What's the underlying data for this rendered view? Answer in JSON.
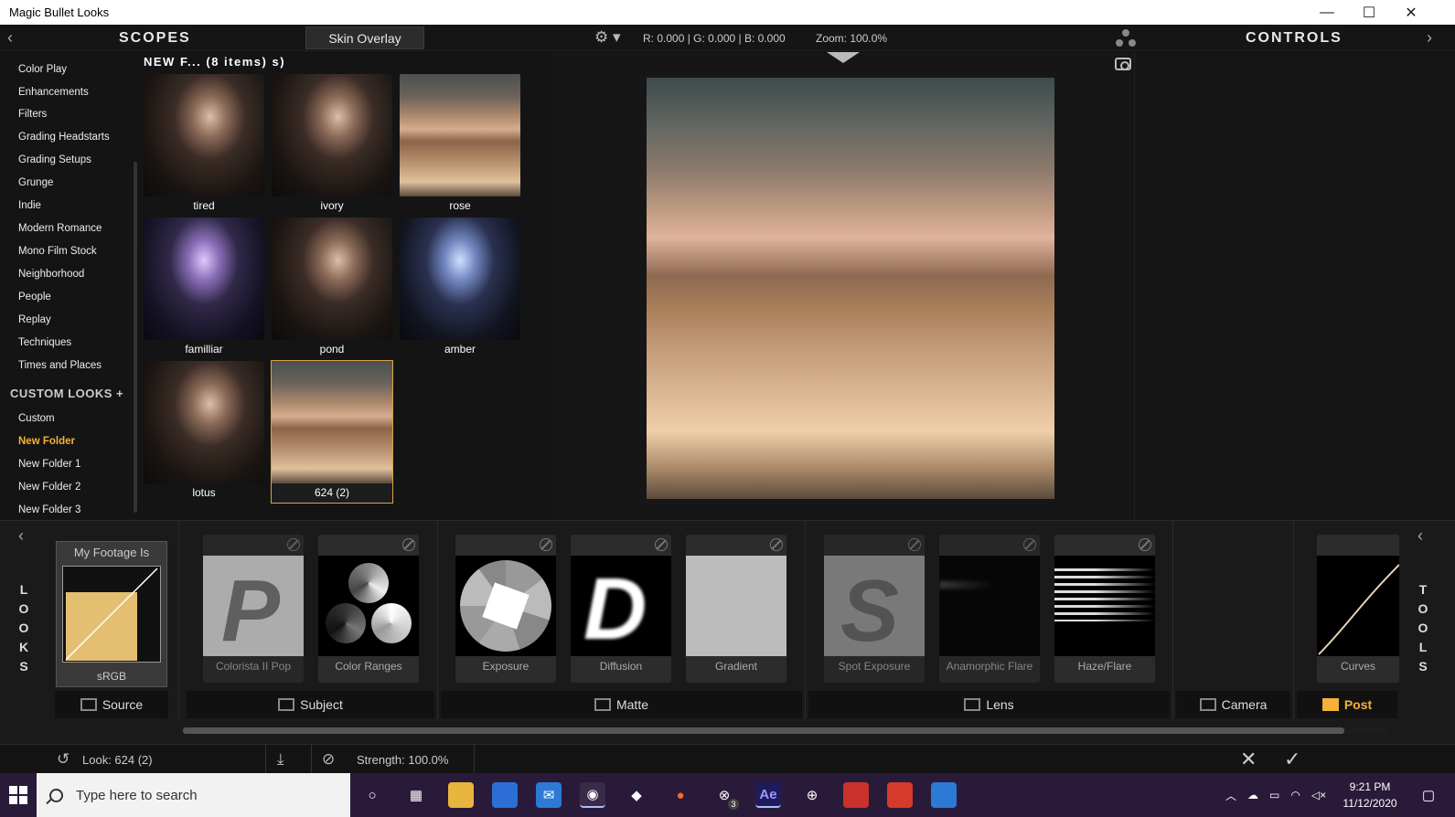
{
  "window": {
    "title": "Magic Bullet Looks",
    "minimize_glyph": "—",
    "maximize_glyph": "☐",
    "close_glyph": "✕"
  },
  "header": {
    "scopes_title": "SCOPES",
    "controls_title": "CONTROLS",
    "skin_tab": "Skin Overlay",
    "rgb_readout": "R: 0.000 | G: 0.000 | B: 0.000",
    "zoom_readout": "Zoom: 100.0%",
    "left_arrow": "‹",
    "right_arrow": "›",
    "gear_glyph": "⚙ ▾"
  },
  "sidebar": {
    "categories": [
      {
        "label": "Color Play"
      },
      {
        "label": "Enhancements"
      },
      {
        "label": "Filters"
      },
      {
        "label": "Grading Headstarts"
      },
      {
        "label": "Grading Setups"
      },
      {
        "label": "Grunge"
      },
      {
        "label": "Indie"
      },
      {
        "label": "Modern Romance"
      },
      {
        "label": "Mono Film Stock"
      },
      {
        "label": "Neighborhood"
      },
      {
        "label": "People"
      },
      {
        "label": "Replay"
      },
      {
        "label": "Techniques"
      },
      {
        "label": "Times and Places"
      }
    ],
    "custom_looks_label": "CUSTOM LOOKS +",
    "custom_folders": [
      {
        "label": "Custom",
        "active": false
      },
      {
        "label": "New Folder",
        "active": true
      },
      {
        "label": "New Folder 1",
        "active": false
      },
      {
        "label": "New Folder 2",
        "active": false
      },
      {
        "label": "New Folder 3",
        "active": false
      }
    ]
  },
  "grid": {
    "header": "NEW F... (8 items)   s)",
    "looks": [
      {
        "label": "tired",
        "style": "portrait"
      },
      {
        "label": "ivory",
        "style": "portrait"
      },
      {
        "label": "rose",
        "style": "blurry"
      },
      {
        "label": "familliar",
        "style": "cool"
      },
      {
        "label": "pond",
        "style": "portrait"
      },
      {
        "label": "amber",
        "style": "blue"
      },
      {
        "label": "lotus",
        "style": "portrait"
      },
      {
        "label": "624 (2)",
        "style": "blurry",
        "selected": true
      }
    ]
  },
  "bottom": {
    "looks_letters": [
      "L",
      "O",
      "O",
      "K",
      "S"
    ],
    "tools_letters": [
      "T",
      "O",
      "O",
      "L",
      "S"
    ],
    "footage": {
      "title": "My Footage Is",
      "label": "sRGB"
    },
    "tools": [
      {
        "label": "Colorista II Pop",
        "icon": "p-letter-icon"
      },
      {
        "label": "Color Ranges",
        "icon": "color-ranges-icon"
      },
      {
        "label": "Exposure",
        "icon": "aperture-icon"
      },
      {
        "label": "Diffusion",
        "icon": "d-letter-icon"
      },
      {
        "label": "Gradient",
        "icon": "gradient-icon"
      },
      {
        "label": "Spot Exposure",
        "icon": "s-letter-icon"
      },
      {
        "label": "Anamorphic Flare",
        "icon": "flare-icon"
      },
      {
        "label": "Haze/Flare",
        "icon": "haze-icon"
      },
      {
        "label": "Curves",
        "icon": "curves-icon"
      }
    ],
    "stages": [
      {
        "label": "Source"
      },
      {
        "label": "Subject"
      },
      {
        "label": "Matte"
      },
      {
        "label": "Lens"
      },
      {
        "label": "Camera"
      },
      {
        "label": "Post",
        "active": true
      }
    ]
  },
  "status": {
    "look_label": "Look:  624 (2)",
    "strength_label": "Strength: 100.0%",
    "cancel_glyph": "✕",
    "ok_glyph": "✓"
  },
  "taskbar": {
    "search_placeholder": "Type here to search",
    "time": "9:21 PM",
    "date": "11/12/2020",
    "xbox_badge": "3",
    "ae_label": "Ae"
  },
  "colors": {
    "accent": "#f4b13a",
    "panel_bg": "#141414",
    "taskbar_bg": "#2a1a39"
  }
}
